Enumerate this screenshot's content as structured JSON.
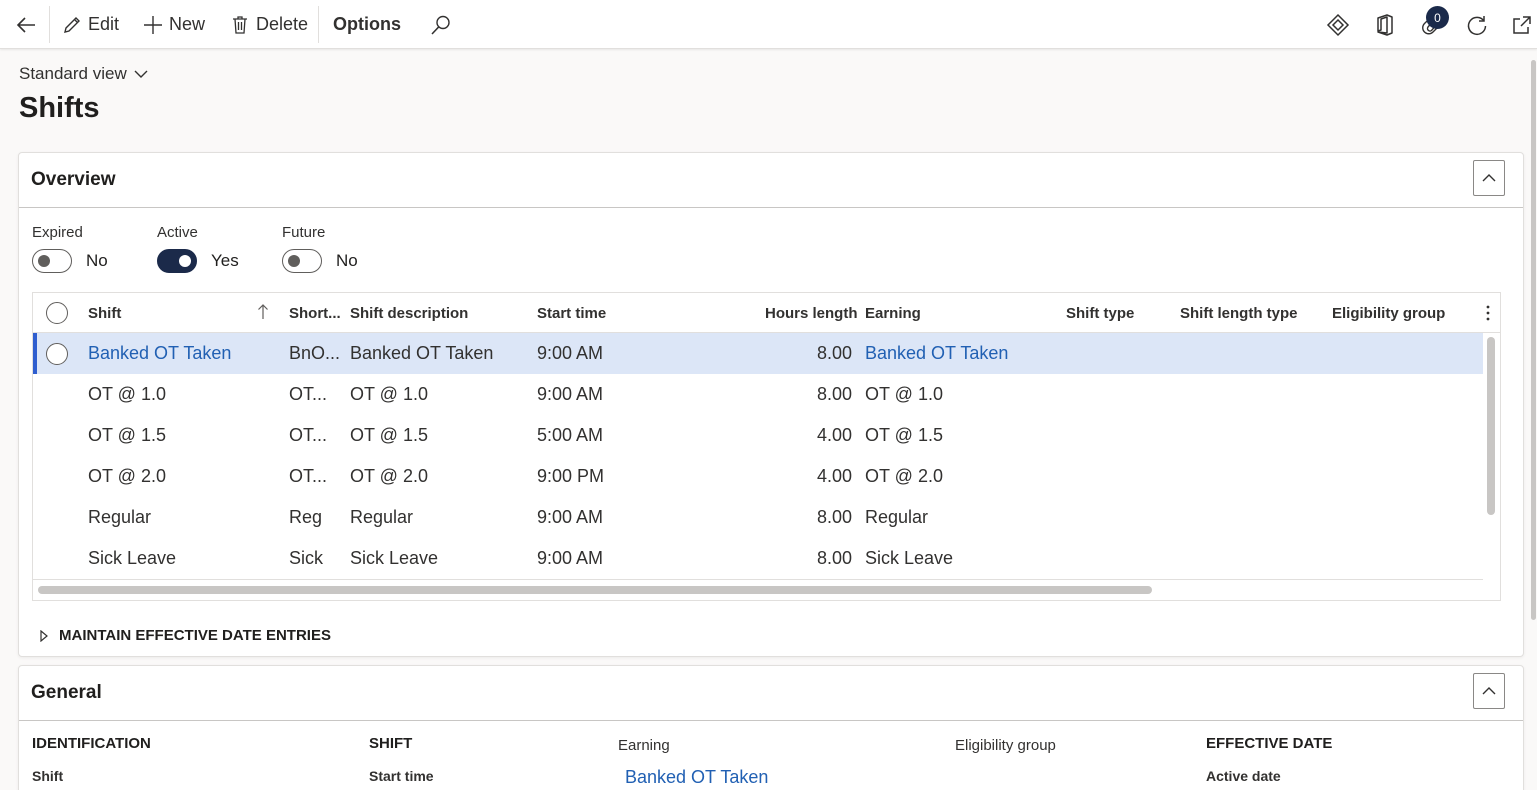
{
  "actionbar": {
    "edit_label": "Edit",
    "new_label": "New",
    "delete_label": "Delete",
    "options_label": "Options",
    "attachments_count": "0"
  },
  "view": {
    "selector_label": "Standard view"
  },
  "page": {
    "title": "Shifts"
  },
  "overview": {
    "title": "Overview",
    "filters": [
      {
        "label": "Expired",
        "value": "No",
        "on": false
      },
      {
        "label": "Active",
        "value": "Yes",
        "on": true
      },
      {
        "label": "Future",
        "value": "No",
        "on": false
      }
    ],
    "columns": {
      "shift": "Shift",
      "short": "Short...",
      "description": "Shift description",
      "start_time": "Start time",
      "hours_length": "Hours length",
      "earning": "Earning",
      "shift_type": "Shift type",
      "shift_length_type": "Shift length type",
      "eligibility_group": "Eligibility group"
    },
    "rows": [
      {
        "shift": "Banked OT Taken",
        "short": "BnO...",
        "description": "Banked OT Taken",
        "start_time": "9:00 AM",
        "hours_length": "8.00",
        "earning": "Banked OT Taken"
      },
      {
        "shift": "OT @ 1.0",
        "short": "OT...",
        "description": "OT @ 1.0",
        "start_time": "9:00 AM",
        "hours_length": "8.00",
        "earning": "OT @ 1.0"
      },
      {
        "shift": "OT @ 1.5",
        "short": "OT...",
        "description": "OT @ 1.5",
        "start_time": "5:00 AM",
        "hours_length": "4.00",
        "earning": "OT @ 1.5"
      },
      {
        "shift": "OT @ 2.0",
        "short": "OT...",
        "description": "OT @ 2.0",
        "start_time": "9:00 PM",
        "hours_length": "4.00",
        "earning": "OT @ 2.0"
      },
      {
        "shift": "Regular",
        "short": "Reg",
        "description": "Regular",
        "start_time": "9:00 AM",
        "hours_length": "8.00",
        "earning": "Regular"
      },
      {
        "shift": "Sick Leave",
        "short": "Sick",
        "description": "Sick Leave",
        "start_time": "9:00 AM",
        "hours_length": "8.00",
        "earning": "Sick Leave"
      }
    ],
    "maintain_label": "MAINTAIN EFFECTIVE DATE ENTRIES"
  },
  "general": {
    "title": "General",
    "identification_header": "IDENTIFICATION",
    "shift_field_label": "Shift",
    "shift_header": "SHIFT",
    "start_time_label": "Start time",
    "earning_label": "Earning",
    "earning_value": "Banked OT Taken",
    "eligibility_label": "Eligibility group",
    "effective_header": "EFFECTIVE DATE",
    "active_date_label": "Active date"
  },
  "colors": {
    "accent": "#1b2a4a",
    "link": "#2160b3",
    "selected_row": "#dce6f7"
  }
}
